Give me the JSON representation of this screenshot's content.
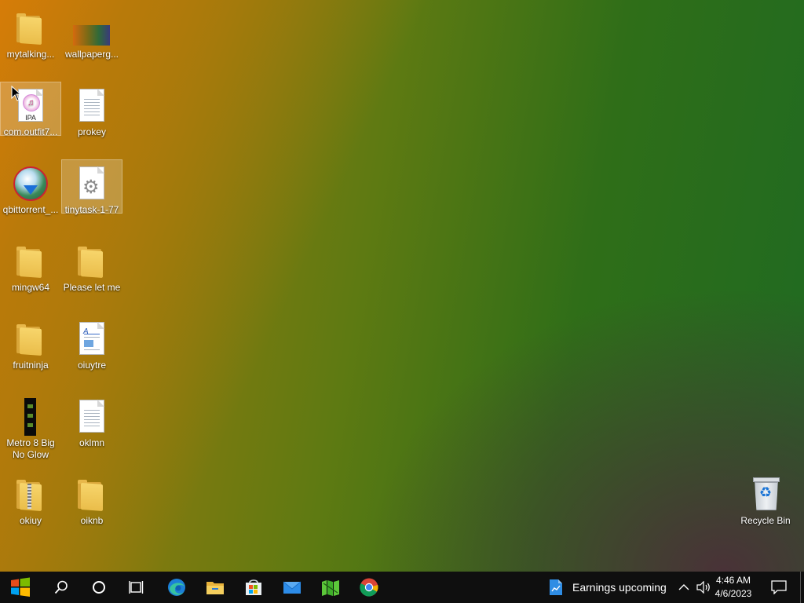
{
  "desktop": {
    "icons": [
      {
        "label": "mytalking...",
        "type": "folder"
      },
      {
        "label": "wallpaperg...",
        "type": "image"
      },
      {
        "label": "com.outfit7...",
        "type": "ipa-file"
      },
      {
        "label": "prokey",
        "type": "text-file"
      },
      {
        "label": "qbittorrent_...",
        "type": "installer"
      },
      {
        "label": "tinytask-1-77",
        "type": "settings-file"
      },
      {
        "label": "mingw64",
        "type": "folder"
      },
      {
        "label": "​Please let me",
        "type": "folder"
      },
      {
        "label": "fruitninja",
        "type": "folder"
      },
      {
        "label": "oiuytre",
        "type": "word-document"
      },
      {
        "label": "Metro 8 Big No Glow",
        "type": "theme-file"
      },
      {
        "label": "oklmn",
        "type": "text-file"
      },
      {
        "label": "okiuy",
        "type": "zip-folder"
      },
      {
        "label": "oiknb",
        "type": "folder"
      },
      {
        "label": "Recycle Bin",
        "type": "recycle-bin"
      }
    ],
    "ipa_badge": "IPA"
  },
  "taskbar": {
    "start": "windows-logo-icon",
    "search": "search-icon",
    "cortana": "cortana-icon",
    "taskview": "task-view-icon",
    "pinned": [
      "edge-icon",
      "file-explorer-icon",
      "microsoft-store-icon",
      "mail-icon",
      "green-app-icon",
      "chrome-icon"
    ],
    "widget_text": "Earnings upcoming",
    "time": "4:46 AM",
    "date": "4/6/2023"
  },
  "colors": {
    "taskbar": "#0f0f0f",
    "folder": "#eabd4a",
    "selection": "rgba(255,255,255,0.22)"
  }
}
